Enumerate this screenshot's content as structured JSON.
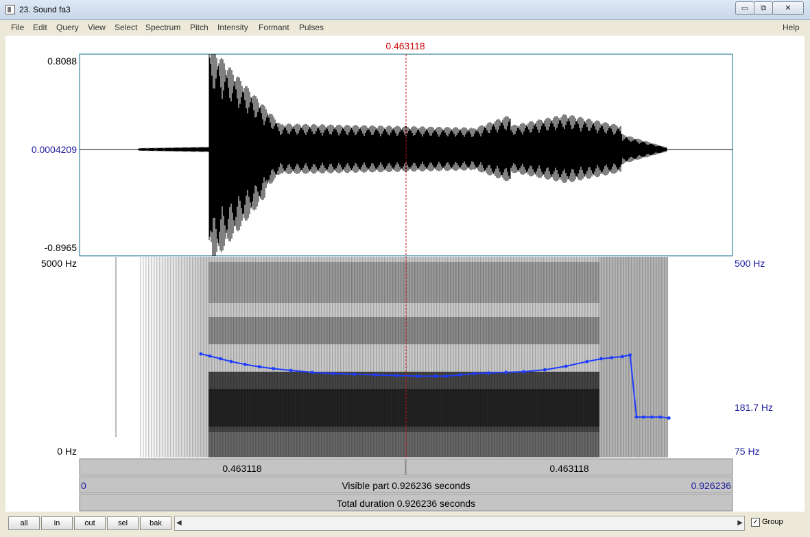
{
  "window": {
    "title": "23. Sound fa3",
    "controls": [
      "▭",
      "⧉",
      "✕"
    ]
  },
  "menu": {
    "items": [
      "File",
      "Edit",
      "Query",
      "View",
      "Select",
      "Spectrum",
      "Pitch",
      "Intensity",
      "Formant",
      "Pulses"
    ],
    "help": "Help"
  },
  "editor": {
    "cursor_time": "0.463118",
    "waveform": {
      "max_label": "0.8088",
      "zero_label": "0.0004209",
      "min_label": "-0.8965"
    },
    "spectrogram": {
      "top_label": "5000 Hz",
      "bottom_label": "0 Hz"
    },
    "pitch": {
      "top_label": "500 Hz",
      "cursor_label": "181.7 Hz",
      "bottom_label": "75 Hz",
      "color": "#1e3cff"
    },
    "bars": {
      "left_segment": "0.463118",
      "right_segment": "0.463118",
      "visible_start": "0",
      "visible_text": "Visible part 0.926236 seconds",
      "visible_end": "0.926236",
      "total_text": "Total duration 0.926236 seconds"
    }
  },
  "bottom": {
    "buttons": [
      "all",
      "in",
      "out",
      "sel",
      "bak"
    ],
    "group_label": "Group",
    "group_checked": "✓"
  },
  "chart_data": {
    "type": "line",
    "x": [
      0.172,
      0.185,
      0.2,
      0.215,
      0.235,
      0.255,
      0.275,
      0.3,
      0.33,
      0.36,
      0.39,
      0.42,
      0.45,
      0.48,
      0.505,
      0.52,
      0.54,
      0.56,
      0.58,
      0.605,
      0.63,
      0.66,
      0.69,
      0.72,
      0.74,
      0.755,
      0.77,
      0.781,
      0.79,
      0.8,
      0.812,
      0.824,
      0.836
    ],
    "series": [
      {
        "values": [
          200,
          196,
          191,
          186,
          181,
          177,
          174,
          171,
          168,
          166,
          165,
          164,
          163,
          162,
          162,
          162,
          164,
          166,
          167,
          168,
          169,
          172,
          178,
          186,
          191,
          193,
          195,
          198,
          110,
          110,
          110,
          110,
          109
        ]
      }
    ],
    "xlim": [
      0,
      0.926236
    ],
    "ylim": [
      75,
      500
    ],
    "grid": false
  }
}
